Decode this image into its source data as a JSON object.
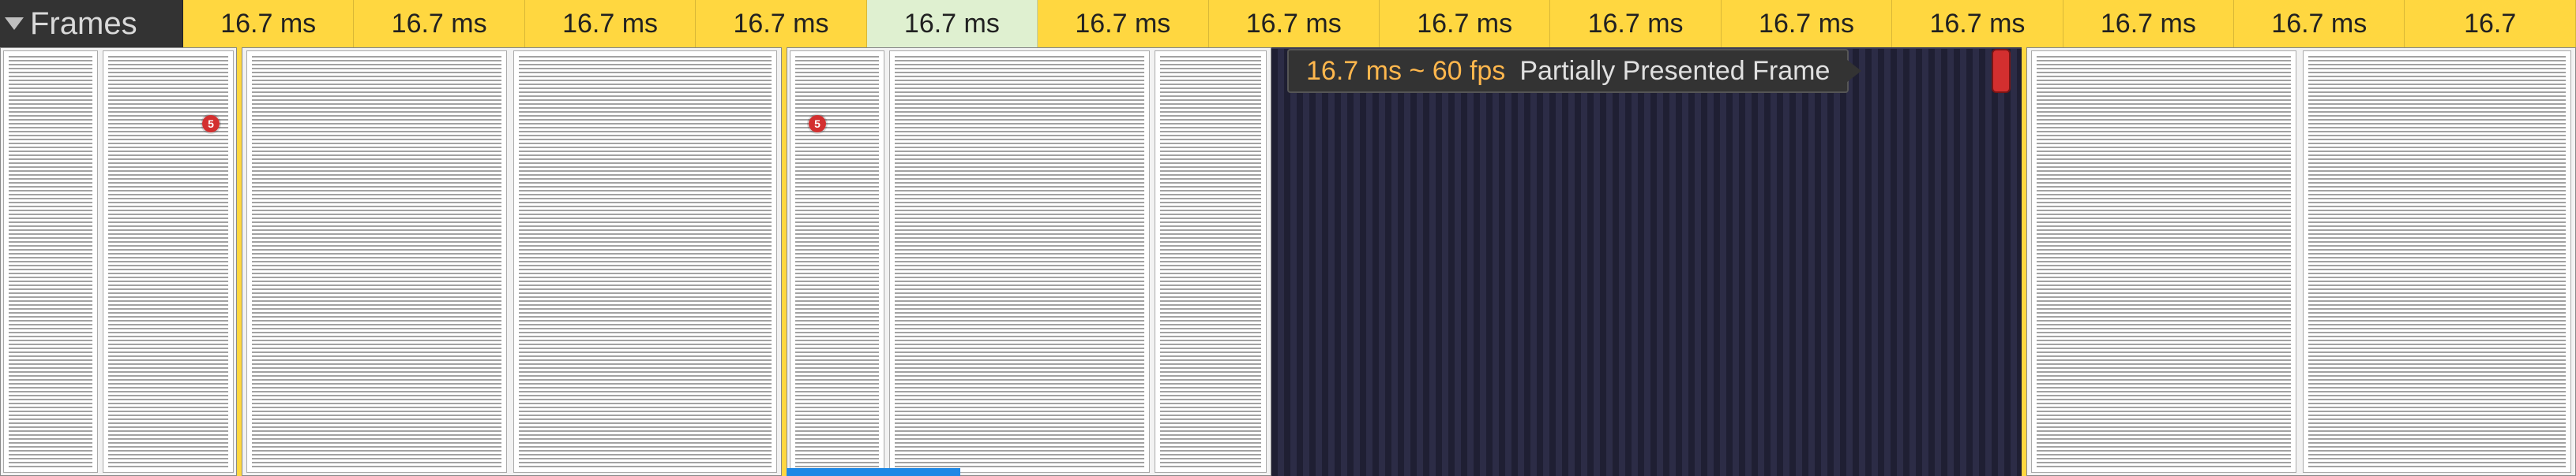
{
  "header": {
    "track_label": "Frames",
    "cells": [
      {
        "label": "16.7 ms",
        "kind": "yellow"
      },
      {
        "label": "16.7 ms",
        "kind": "yellow"
      },
      {
        "label": "16.7 ms",
        "kind": "yellow"
      },
      {
        "label": "16.7 ms",
        "kind": "yellow"
      },
      {
        "label": "16.7 ms",
        "kind": "green"
      },
      {
        "label": "16.7 ms",
        "kind": "yellow"
      },
      {
        "label": "16.7 ms",
        "kind": "yellow"
      },
      {
        "label": "16.7 ms",
        "kind": "yellow"
      },
      {
        "label": "16.7 ms",
        "kind": "yellow"
      },
      {
        "label": "16.7 ms",
        "kind": "yellow"
      },
      {
        "label": "16.7 ms",
        "kind": "yellow"
      },
      {
        "label": "16.7 ms",
        "kind": "yellow"
      },
      {
        "label": "16.7 ms",
        "kind": "yellow"
      },
      {
        "label": "16.7",
        "kind": "yellow"
      }
    ]
  },
  "tooltip": {
    "fps_text": "16.7 ms ~ 60 fps",
    "label": "Partially Presented Frame"
  },
  "badge_text": "5",
  "colors": {
    "yellow": "#ffd740",
    "green": "#dff0d0",
    "tooltip_bg": "#333333",
    "fps_color": "#ffb74d",
    "red": "#d32f2f",
    "blue": "#1e88e5"
  }
}
